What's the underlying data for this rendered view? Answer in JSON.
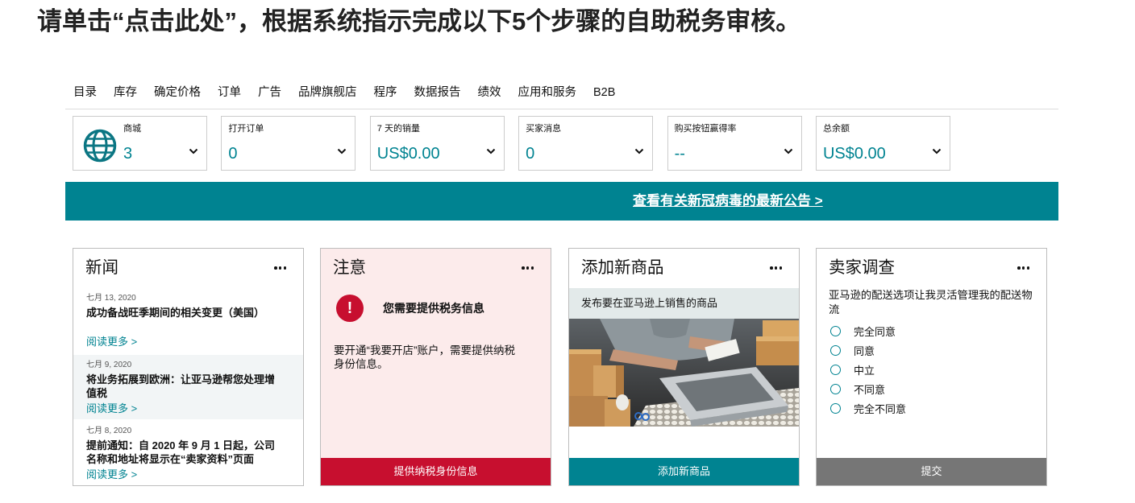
{
  "instruction": "请单击“点击此处”，根据系统指示完成以下5个步骤的自助税务审核。",
  "theme": {
    "teal": "#008391",
    "red": "#c70f2f",
    "gray-btn": "#767676",
    "alert-bg": "#fcebeb",
    "band-bg": "#e3eaea",
    "news-alt": "#f2f5f6"
  },
  "nav": {
    "items": [
      "目录",
      "库存",
      "确定价格",
      "订单",
      "广告",
      "品牌旗舰店",
      "程序",
      "数据报告",
      "绩效",
      "应用和服务",
      "B2B"
    ]
  },
  "metrics": [
    {
      "label": "商城",
      "value": "3",
      "icon": "globe-icon"
    },
    {
      "label": "打开订单",
      "value": "0"
    },
    {
      "label": "7 天的销量",
      "value": "US$0.00"
    },
    {
      "label": "买家消息",
      "value": "0"
    },
    {
      "label": "购买按钮赢得率",
      "value": "--"
    },
    {
      "label": "总余额",
      "value": "US$0.00"
    }
  ],
  "metric_expand_icon": "chevron-down-icon",
  "banner": {
    "link": "查看有关新冠病毒的最新公告 >"
  },
  "news": {
    "title": "新闻",
    "menu_icon": "more-icon",
    "items": [
      {
        "date": "七月 13, 2020",
        "headline": "成功备战旺季期间的相关变更（美国）",
        "read_more": "阅读更多 >"
      },
      {
        "date": "七月 9, 2020",
        "headline": "将业务拓展到欧洲：让亚马逊帮您处理增值税",
        "read_more": "阅读更多 >"
      },
      {
        "date": "七月 8, 2020",
        "headline": "提前通知：自 2020 年 9 月 1 日起，公司名称和地址将显示在“卖家资料”页面",
        "read_more": "阅读更多 >"
      }
    ]
  },
  "alert": {
    "title": "注意",
    "menu_icon": "more-icon",
    "icon": "exclamation-icon",
    "icon_glyph": "!",
    "heading": "您需要提供税务信息",
    "message": "要开通“我要开店”账户，需要提供纳税身份信息。",
    "button": "提供纳税身份信息"
  },
  "add_product": {
    "title": "添加新商品",
    "menu_icon": "more-icon",
    "subtitle": "发布要在亚马逊上销售的商品",
    "image": "product-photo",
    "button": "添加新商品"
  },
  "survey": {
    "title": "卖家调查",
    "menu_icon": "more-icon",
    "question": "亚马逊的配送选项让我灵活管理我的配送物流",
    "options": [
      "完全同意",
      "同意",
      "中立",
      "不同意",
      "完全不同意"
    ],
    "selected": null,
    "button": "提交"
  }
}
